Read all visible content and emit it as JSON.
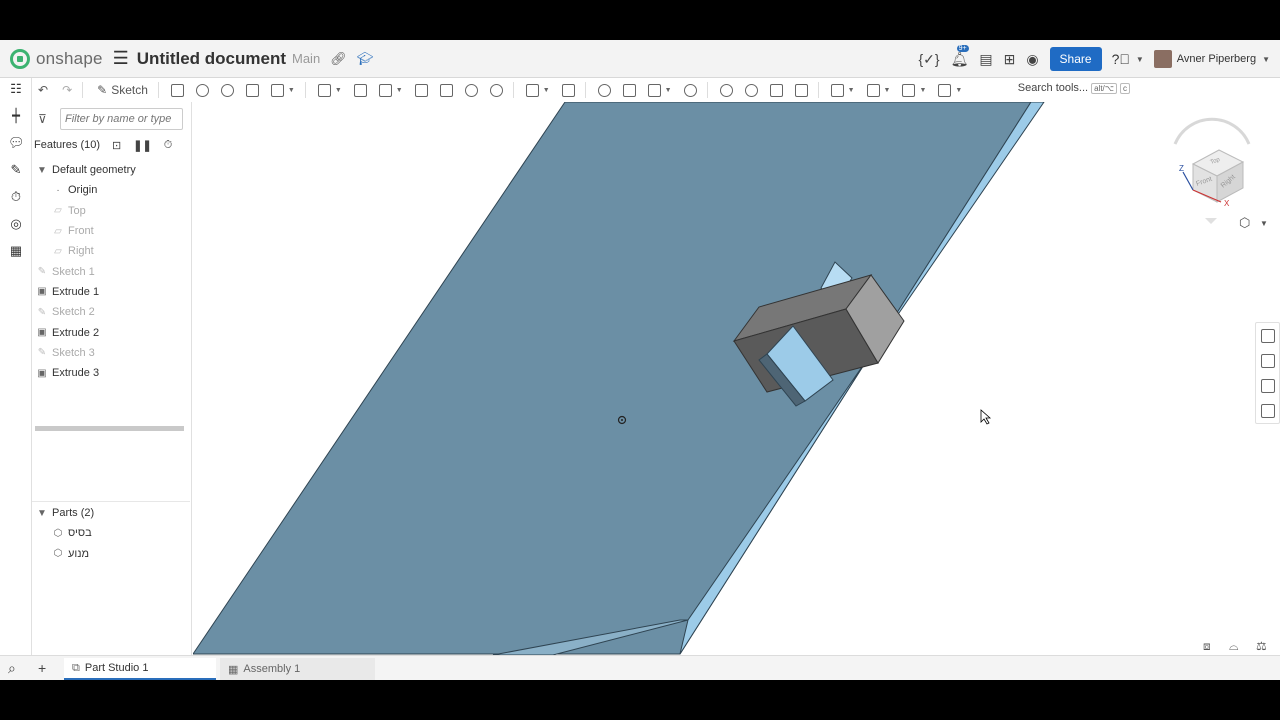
{
  "app": {
    "logo_text": "onshape",
    "document_title": "Untitled document",
    "branch": "Main",
    "share_label": "Share",
    "notification_count": "9+",
    "user_name": "Avner Piperberg"
  },
  "toolbar": {
    "sketch_label": "Sketch",
    "search_label": "Search tools...",
    "search_shortcut_1": "alt/⌥",
    "search_shortcut_2": "c"
  },
  "panel": {
    "filter_placeholder": "Filter by name or type",
    "features_title": "Features (10)",
    "default_geometry": "Default geometry",
    "geometry": [
      "Origin",
      "Top",
      "Front",
      "Right"
    ],
    "features": [
      "Sketch 1",
      "Extrude 1",
      "Sketch 2",
      "Extrude 2",
      "Sketch 3",
      "Extrude 3"
    ],
    "parts_title": "Parts (2)",
    "parts": [
      "בסיס",
      "מנוע"
    ]
  },
  "viewcube": {
    "faces": [
      "Top",
      "Front",
      "Right"
    ],
    "axes": [
      "Z",
      "X"
    ]
  },
  "tabs": [
    {
      "label": "Part Studio 1",
      "active": true
    },
    {
      "label": "Assembly 1",
      "active": false
    }
  ],
  "colors": {
    "plate_top": "#6b8fa5",
    "plate_edge": "#9ccbe8",
    "block_gray": "#6f6f6f",
    "brand_green": "#3cb371",
    "share_blue": "#1f6bc4"
  },
  "icons": {
    "undo": "undo-icon",
    "redo": "redo-icon",
    "sketch": "pencil-icon",
    "help": "help-icon",
    "bell": "bell-icon"
  }
}
